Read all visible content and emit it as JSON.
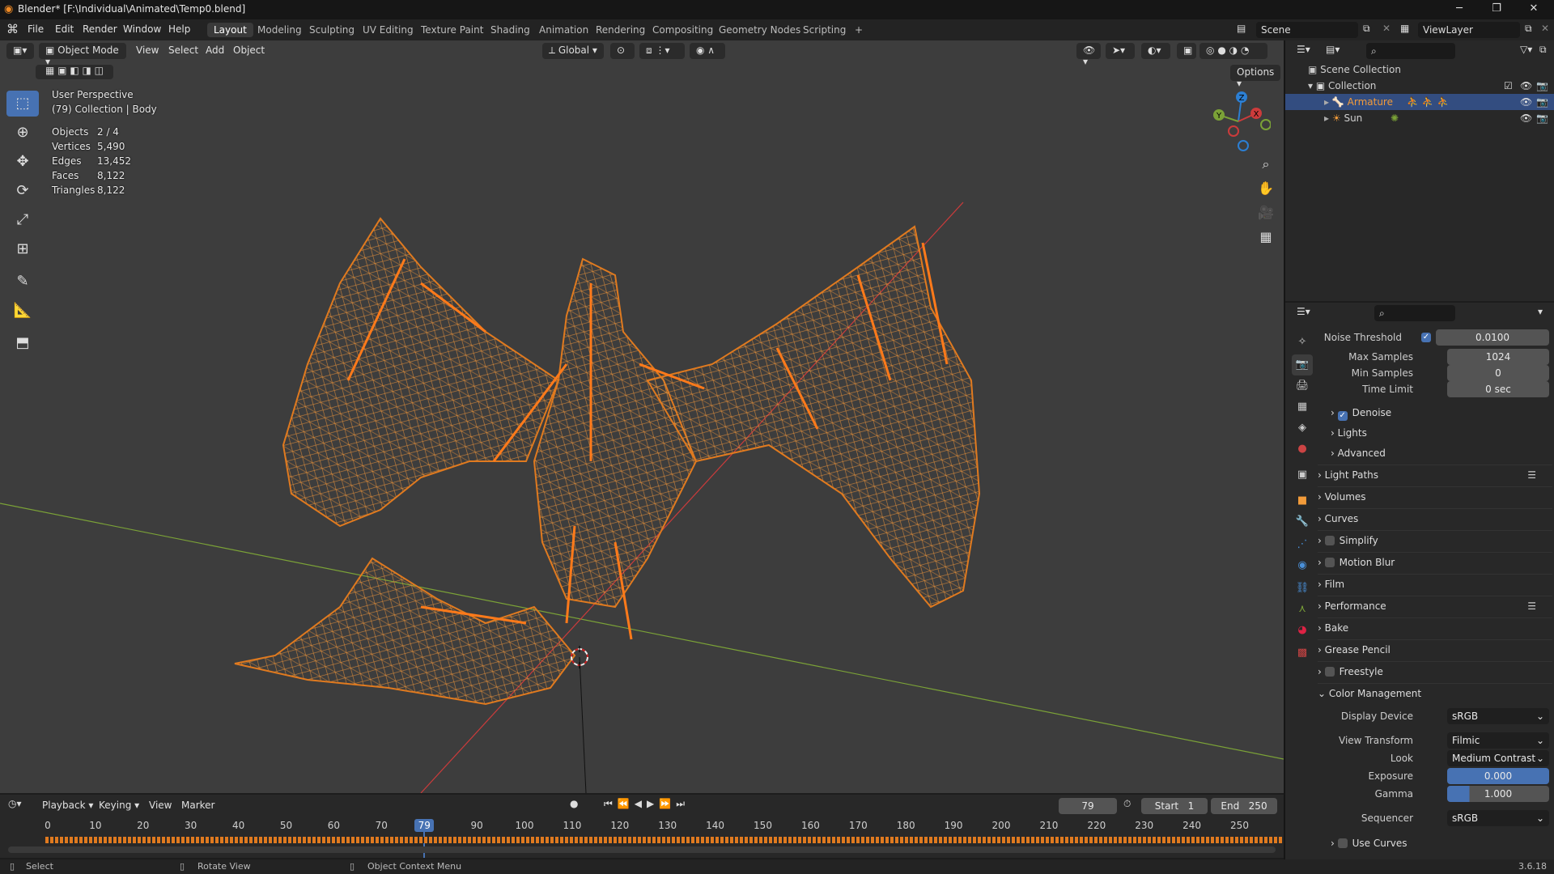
{
  "window": {
    "title": "Blender* [F:\\Individual\\Animated\\Temp0.blend]",
    "version": "3.6.18"
  },
  "menus": [
    "File",
    "Edit",
    "Render",
    "Window",
    "Help"
  ],
  "workspaces": [
    {
      "label": "Layout",
      "active": true
    },
    {
      "label": "Modeling"
    },
    {
      "label": "Sculpting"
    },
    {
      "label": "UV Editing"
    },
    {
      "label": "Texture Paint"
    },
    {
      "label": "Shading"
    },
    {
      "label": "Animation"
    },
    {
      "label": "Rendering"
    },
    {
      "label": "Compositing"
    },
    {
      "label": "Geometry Nodes"
    },
    {
      "label": "Scripting"
    }
  ],
  "scene": {
    "name": "Scene",
    "view_layer": "ViewLayer"
  },
  "viewport_header": {
    "mode": "Object Mode",
    "menus": [
      "View",
      "Select",
      "Add",
      "Object"
    ],
    "orientation": "Global",
    "options": "Options"
  },
  "viewport_overlay": {
    "perspective": "User Perspective",
    "collection": "(79) Collection | Body",
    "stats": [
      {
        "label": "Objects",
        "value": "2 / 4"
      },
      {
        "label": "Vertices",
        "value": "5,490"
      },
      {
        "label": "Edges",
        "value": "13,452"
      },
      {
        "label": "Faces",
        "value": "8,122"
      },
      {
        "label": "Triangles",
        "value": "8,122"
      }
    ]
  },
  "gizmo": {
    "x": "X",
    "y": "Y",
    "z": "Z"
  },
  "outliner": {
    "scene_collection": "Scene Collection",
    "collection": "Collection",
    "items": [
      {
        "label": "Armature"
      },
      {
        "label": "Sun"
      }
    ]
  },
  "properties": {
    "sampling": [
      {
        "label": "Noise Threshold",
        "value": "0.0100",
        "checked": true
      },
      {
        "label": "Max Samples",
        "value": "1024"
      },
      {
        "label": "Min Samples",
        "value": "0"
      },
      {
        "label": "Time Limit",
        "value": "0 sec"
      }
    ],
    "sub_panels": [
      {
        "label": "Denoise",
        "checkbox": true
      },
      {
        "label": "Lights"
      },
      {
        "label": "Advanced"
      }
    ],
    "sections": [
      {
        "label": "Light Paths",
        "has_list": true
      },
      {
        "label": "Volumes"
      },
      {
        "label": "Curves"
      },
      {
        "label": "Simplify",
        "checkbox": true
      },
      {
        "label": "Motion Blur",
        "checkbox": true
      },
      {
        "label": "Film"
      },
      {
        "label": "Performance",
        "has_list": true
      },
      {
        "label": "Bake"
      },
      {
        "label": "Grease Pencil"
      },
      {
        "label": "Freestyle",
        "checkbox": true
      },
      {
        "label": "Color Management",
        "expanded": true
      }
    ],
    "color_management": {
      "display_device_label": "Display Device",
      "display_device": "sRGB",
      "view_transform_label": "View Transform",
      "view_transform": "Filmic",
      "look_label": "Look",
      "look": "Medium Contrast",
      "exposure_label": "Exposure",
      "exposure": "0.000",
      "gamma_label": "Gamma",
      "gamma": "1.000",
      "sequencer_label": "Sequencer",
      "sequencer": "sRGB",
      "use_curves": "Use Curves"
    }
  },
  "timeline": {
    "menus": [
      "Playback",
      "Keying",
      "View",
      "Marker"
    ],
    "current_frame": "79",
    "start_label": "Start",
    "start": "1",
    "end_label": "End",
    "end": "250",
    "ticks": [
      "0",
      "10",
      "20",
      "30",
      "40",
      "50",
      "60",
      "70",
      "79",
      "90",
      "100",
      "110",
      "120",
      "130",
      "140",
      "150",
      "160",
      "170",
      "180",
      "190",
      "200",
      "210",
      "220",
      "230",
      "240",
      "250"
    ]
  },
  "statusbar": {
    "select": "Select",
    "rotate": "Rotate View",
    "context": "Object Context Menu"
  },
  "colors": {
    "accent": "#4772b3",
    "selection_orange": "#e07a1f",
    "active_item": "#f29b3a",
    "x_axis": "#cc3b3b",
    "y_axis": "#7ba237",
    "z_axis": "#2c7fd3"
  }
}
